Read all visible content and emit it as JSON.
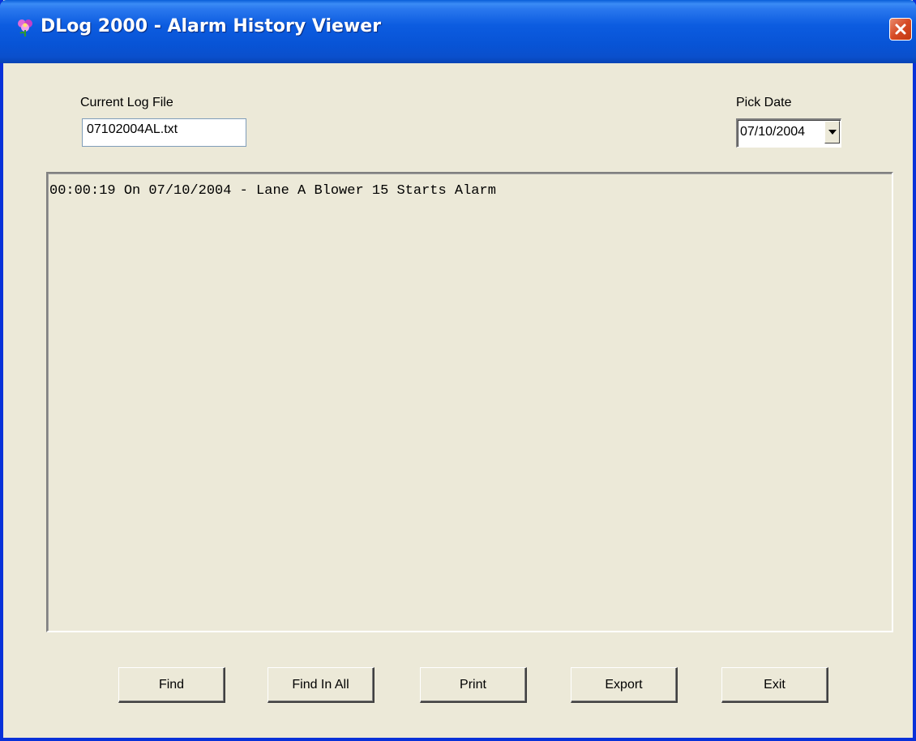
{
  "window": {
    "title": "DLog 2000 - Alarm History Viewer"
  },
  "log_file": {
    "label": "Current Log File",
    "value": "07102004AL.txt"
  },
  "pick_date": {
    "label": "Pick Date",
    "value": "07/10/2004"
  },
  "log_entries": [
    "00:00:19 On 07/10/2004 - Lane A Blower 15 Starts Alarm"
  ],
  "buttons": {
    "find": "Find",
    "find_in_all": "Find In All",
    "print": "Print",
    "export": "Export",
    "exit": "Exit"
  },
  "colors": {
    "titlebar": "#0854d6",
    "window_face": "#ece9d8",
    "close_button": "#d64a25"
  },
  "icons": {
    "app": "app-flower-icon",
    "close": "close-icon",
    "dropdown": "chevron-down-icon"
  }
}
